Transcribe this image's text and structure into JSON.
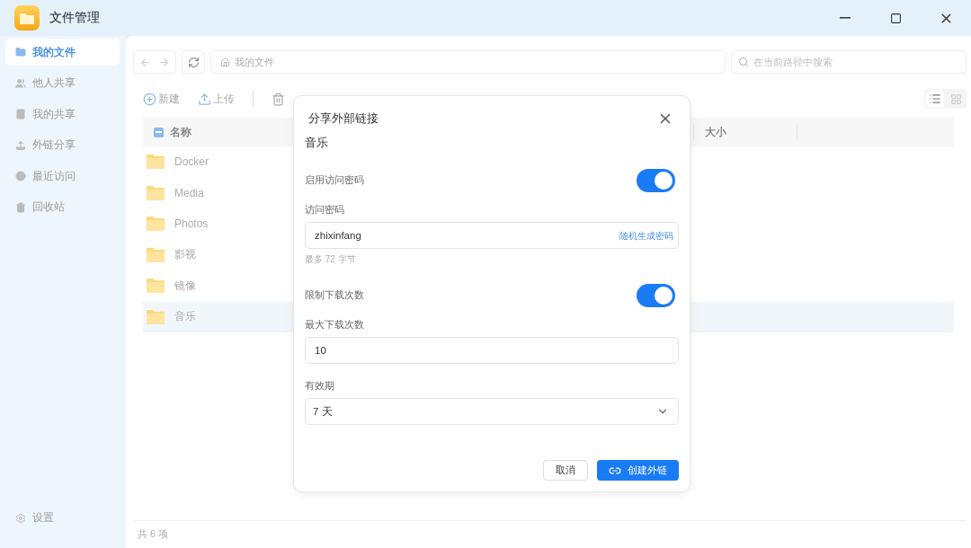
{
  "window": {
    "title": "文件管理"
  },
  "sidebar": {
    "items": [
      {
        "label": "我的文件",
        "selected": true
      },
      {
        "label": "他人共享",
        "selected": false
      },
      {
        "label": "我的共享",
        "selected": false
      },
      {
        "label": "外链分享",
        "selected": false
      },
      {
        "label": "最近访问",
        "selected": false
      },
      {
        "label": "回收站",
        "selected": false
      }
    ],
    "settings": "设置"
  },
  "nav": {
    "path": "我的文件",
    "search_placeholder": "在当前路径中搜索"
  },
  "toolbar": {
    "items": [
      {
        "label": "新建",
        "kind": "new"
      },
      {
        "label": "上传",
        "kind": "upload"
      }
    ]
  },
  "table": {
    "select_all": {
      "checked": true
    },
    "columns": [
      "名称",
      "大小"
    ],
    "rows": [
      {
        "name": "Docker",
        "selected": false
      },
      {
        "name": "Media",
        "selected": false
      },
      {
        "name": "Photos",
        "selected": false
      },
      {
        "name": "影视",
        "selected": false
      },
      {
        "name": "镜像",
        "selected": false
      },
      {
        "name": "音乐",
        "selected": true
      }
    ]
  },
  "status_bar": "共 6 项",
  "dialog": {
    "title": "分享外部链接",
    "file": "音乐",
    "password_toggle": {
      "label": "启用访问密码",
      "on": true
    },
    "password": {
      "label": "访问密码",
      "value": "zhixinfang",
      "action": "随机生成密码",
      "hint": "最多 72 字节"
    },
    "limit_toggle": {
      "label": "限制下载次数",
      "on": true
    },
    "max_downloads": {
      "label": "最大下载次数",
      "value": "10"
    },
    "expiry": {
      "label": "有效期",
      "value": "7 天"
    },
    "buttons": {
      "cancel": "取消",
      "confirm": "创建外链"
    }
  }
}
